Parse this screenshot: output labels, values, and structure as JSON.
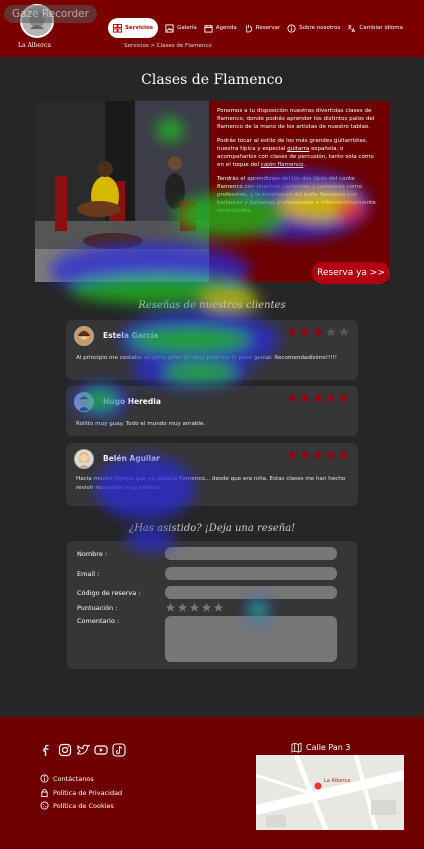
{
  "overlay": {
    "label": "Gaze Recorder"
  },
  "brand": {
    "name": "La Alberca"
  },
  "nav": {
    "items": [
      {
        "label": "Servicios",
        "icon": "grid-icon",
        "active": true
      },
      {
        "label": "Galería",
        "icon": "gallery-icon"
      },
      {
        "label": "Agenda",
        "icon": "calendar-icon"
      },
      {
        "label": "Reservar",
        "icon": "hand-icon"
      },
      {
        "label": "Sobre nosotros",
        "icon": "info-icon"
      },
      {
        "label": "Cambiar idioma",
        "icon": "translate-icon"
      }
    ]
  },
  "breadcrumb": "Servicios > Clases de Flamenco",
  "page": {
    "title": "Clases de Flamenco"
  },
  "intro": {
    "p1": "Ponemos a tu disposición nuestras divertidas clases de flamenco, donde podrás aprender los distintos palos del flamenco de la mano de los artistas de nuestro tablao.",
    "p2_a": "Podrás tocar al estilo de los más grandes guitarristas, nuestra típica y especial ",
    "p2_link1": "guitarra",
    "p2_b": " española, o acompañarlos con clases de percusión, tanto sola como en el toque del ",
    "p2_link2": "cajón flamenco",
    "p2_c": ".",
    "p3": "Tendrás el aprendizaje del los dos tipos del cante flamenco con nuestros cantantes y cantaoras como profesores, y la enseñanza del baile flamenco con bailaoras y bailaoras profesionales e internacionalmente reconocidos.",
    "reserve_label": "Reserva ya >>"
  },
  "reviews": {
    "title": "Reseñas de nuestros clientes",
    "items": [
      {
        "name": "Estela García",
        "rating": 3,
        "text": "Al principio me costaba un poco pillar el ritmo pero me lo pase genial. Recomendadísimo!!!!!"
      },
      {
        "name": "Hugo Heredia",
        "rating": 5,
        "text": "Rollito muy guay. Todo el mundo muy amable."
      },
      {
        "name": "Belén Aguilar",
        "rating": 5,
        "text": "Hacía mucho tiempo que no bailaba flamenco... desde que era niña. Estas clases me han hecho revivir recuerdos muy bonitos."
      }
    ]
  },
  "form": {
    "title": "¿Has asistido? ¡Deja una reseña!",
    "name_label": "Nombre :",
    "email_label": "Email :",
    "code_label": "Código de reserva :",
    "rating_label": "Puntuación :",
    "comment_label": "Comentario :"
  },
  "footer": {
    "social": [
      "facebook-icon",
      "instagram-icon",
      "twitter-icon",
      "youtube-icon",
      "tiktok-icon"
    ],
    "links": [
      {
        "label": "Contáctanos",
        "icon": "info-icon"
      },
      {
        "label": "Política de Privacidad",
        "icon": "lock-icon"
      },
      {
        "label": "Política de Cookies",
        "icon": "cookie-icon"
      }
    ],
    "address": "Calle Pan 3",
    "map_label": "La Alberca"
  },
  "colors": {
    "brand": "#7a0000",
    "accent": "#b00012",
    "star_on": "#9b0012",
    "star_off": "#555555"
  }
}
